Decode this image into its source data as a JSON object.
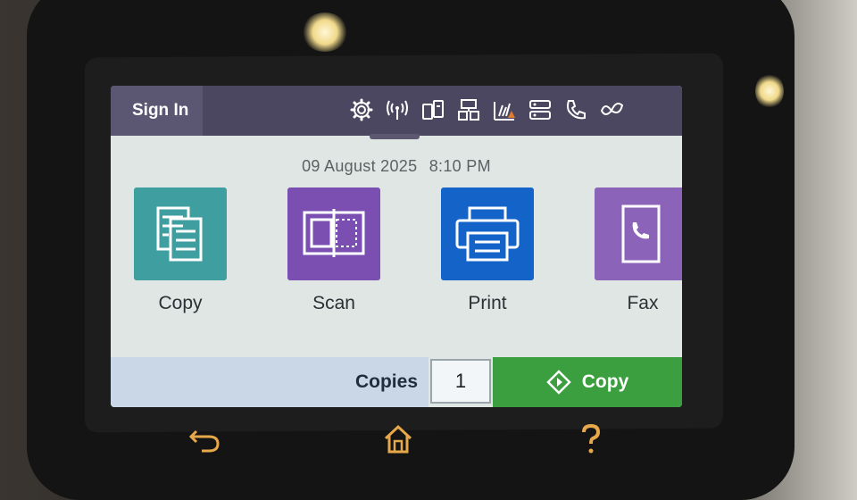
{
  "header": {
    "sign_in_label": "Sign In",
    "status_icons": [
      "gear-icon",
      "wireless-icon",
      "wifi-direct-icon",
      "network-icon",
      "ink-levels-icon",
      "eprint-icon",
      "fax-status-icon",
      "eco-icon"
    ],
    "ink_warning_color": "#e07a2c"
  },
  "datetime": {
    "date": "09 August 2025",
    "time": "8:10 PM"
  },
  "apps": [
    {
      "label": "Copy",
      "icon": "copy-icon",
      "color": "#3f9e9f"
    },
    {
      "label": "Scan",
      "icon": "scan-icon",
      "color": "#7a4fb1"
    },
    {
      "label": "Print",
      "icon": "print-icon",
      "color": "#1463c9"
    },
    {
      "label": "Fax",
      "icon": "fax-icon",
      "color": "#8b63b8"
    }
  ],
  "bottom_bar": {
    "copies_label": "Copies",
    "copies_value": "1",
    "copy_button_label": "Copy",
    "copy_button_color": "#3b9f3f"
  },
  "hardware_buttons": [
    "back-icon",
    "home-icon",
    "help-icon"
  ]
}
